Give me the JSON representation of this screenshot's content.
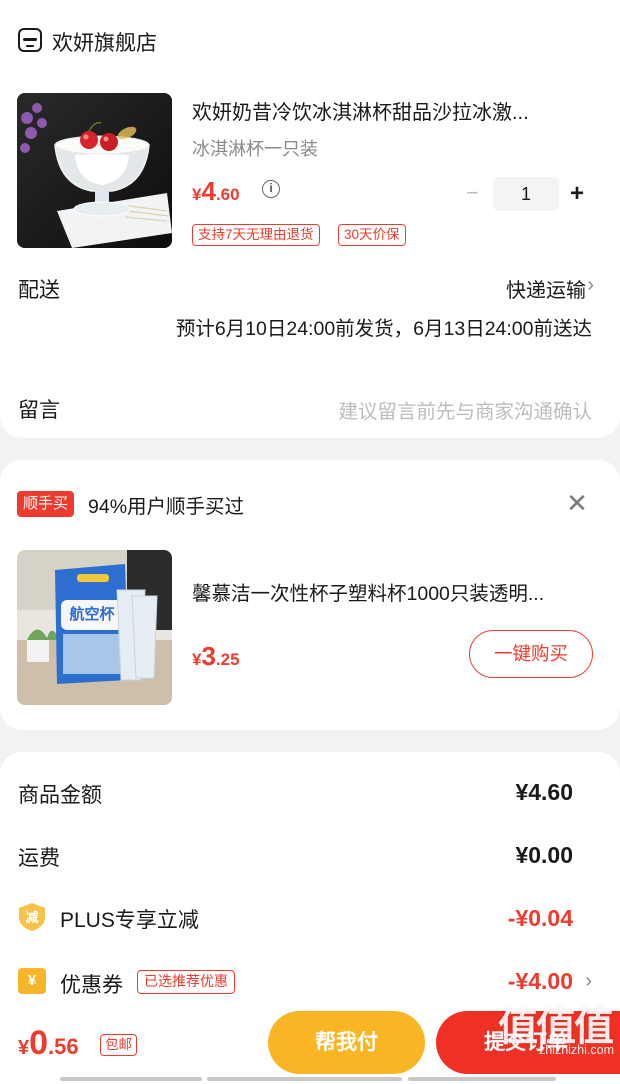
{
  "shop": {
    "name": "欢妍旗舰店"
  },
  "product": {
    "title": "欢妍奶昔冷饮冰淇淋杯甜品沙拉冰激...",
    "spec": "冰淇淋杯一只装",
    "price_symbol": "¥",
    "price_int": "4",
    "price_dec": ".60",
    "quantity": "1",
    "tags": [
      "支持7天无理由退货",
      "30天价保"
    ]
  },
  "delivery": {
    "label": "配送",
    "method": "快递运输",
    "estimate": "预计6月10日24:00前发货，6月13日24:00前送达"
  },
  "message": {
    "label": "留言",
    "placeholder": "建议留言前先与商家沟通确认"
  },
  "upsell": {
    "badge": "顺手买",
    "title": "94%用户顺手买过",
    "product_title": "馨慕洁一次性杯子塑料杯1000只装透明...",
    "price_symbol": "¥",
    "price_int": "3",
    "price_dec": ".25",
    "buy_label": "一键购买",
    "image_text": "航空杯"
  },
  "summary": {
    "goods_label": "商品金额",
    "goods_value": "¥4.60",
    "shipping_label": "运费",
    "shipping_value": "¥0.00",
    "plus_icon_text": "减",
    "plus_label": "PLUS专享立减",
    "plus_value": "-¥0.04",
    "coupon_icon_text": "¥",
    "coupon_label": "优惠券",
    "coupon_tag": "已选推荐优惠",
    "coupon_value": "-¥4.00"
  },
  "bottom": {
    "total_symbol": "¥",
    "total_int": "0",
    "total_dec": ".56",
    "free_shipping": "包邮",
    "help_pay": "帮我付",
    "pay": "提交订单"
  },
  "watermark": {
    "logo": "值什么值得买",
    "url": "zhizhizhi.com"
  },
  "colors": {
    "accent": "#ef3b2d",
    "help_button": "#f9b523",
    "pay_button": "#ef3024",
    "muted": "#8a8a8a"
  }
}
